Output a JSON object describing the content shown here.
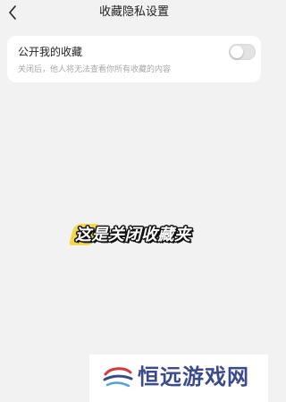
{
  "header": {
    "title": "收藏隐私设置"
  },
  "setting": {
    "title": "公开我的收藏",
    "description": "关闭后，他人将无法查看你所有收藏的内容",
    "toggle_on": false
  },
  "caption": {
    "text": "这是关闭收藏夹"
  },
  "watermark": {
    "text": "恒远游戏网"
  },
  "colors": {
    "background": "#f2f2f2",
    "card": "#ffffff",
    "highlight": "#f2d94a",
    "watermark_text": "#3b4a8c"
  }
}
